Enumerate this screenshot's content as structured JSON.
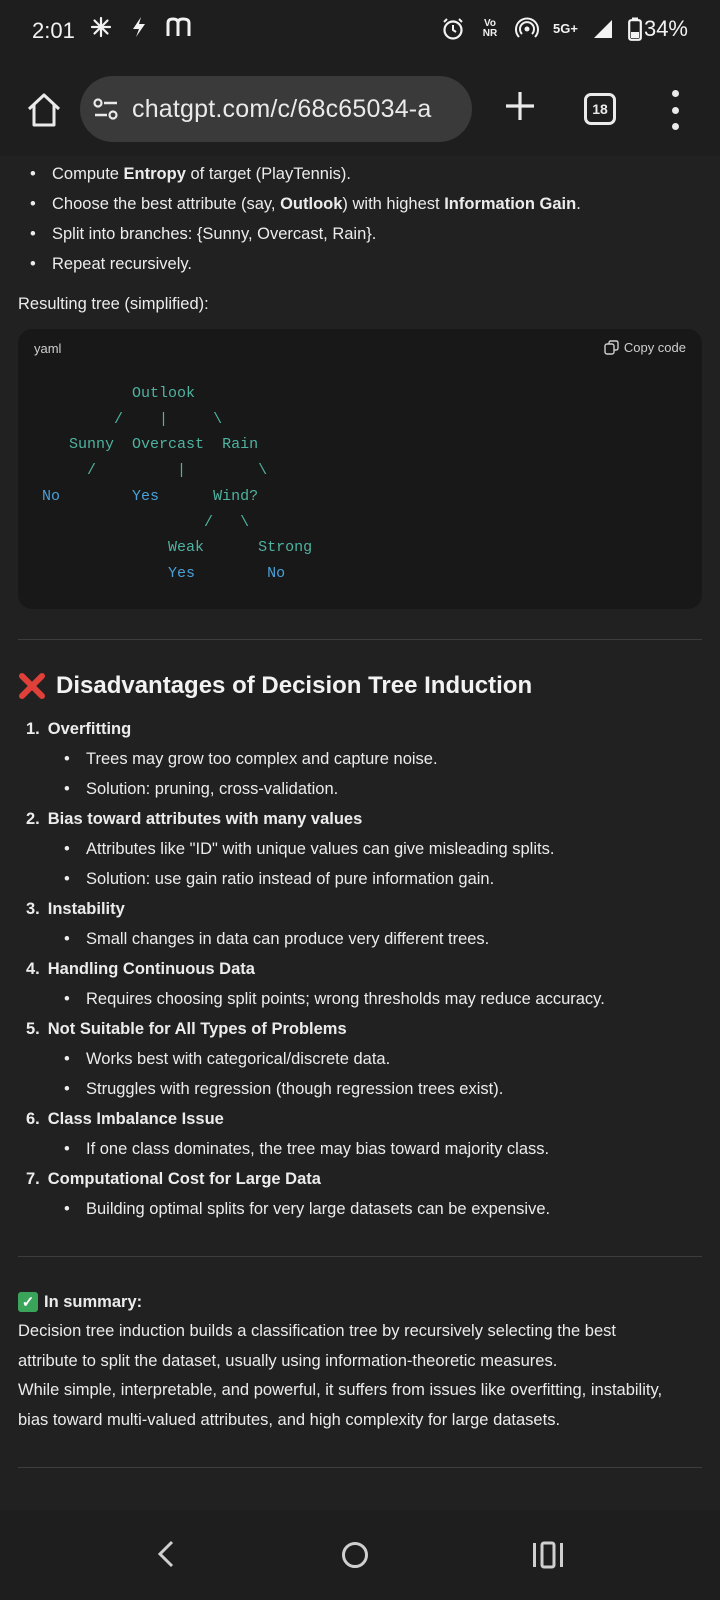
{
  "status_bar": {
    "time": "2:01",
    "left_icons": [
      "pinwheel-icon",
      "lightning-icon",
      "m-app-icon"
    ],
    "volte": "Vo NR",
    "network": "5G+",
    "battery": "34%"
  },
  "browser": {
    "url": "chatgpt.com/c/68c65034-a",
    "tab_count": "18"
  },
  "content": {
    "steps": [
      {
        "parts": [
          {
            "t": "Compute ",
            "b": false
          },
          {
            "t": "Entropy",
            "b": true
          },
          {
            "t": " of target (PlayTennis).",
            "b": false
          }
        ]
      },
      {
        "parts": [
          {
            "t": "Choose the best attribute (say, ",
            "b": false
          },
          {
            "t": "Outlook",
            "b": true
          },
          {
            "t": ") with highest ",
            "b": false
          },
          {
            "t": "Information Gain",
            "b": true
          },
          {
            "t": ".",
            "b": false
          }
        ]
      },
      {
        "parts": [
          {
            "t": "Split into branches: {Sunny, Overcast, Rain}.",
            "b": false
          }
        ]
      },
      {
        "parts": [
          {
            "t": "Repeat recursively.",
            "b": false
          }
        ]
      }
    ],
    "resulting_label": "Resulting tree (simplified):",
    "code": {
      "language": "yaml",
      "copy_label": "Copy code",
      "lines": [
        "          Outlook",
        "        /    |     \\",
        "   Sunny  Overcast  Rain",
        "     /         |        \\",
        "No        Yes      Wind?",
        "                  /   \\",
        "              Weak      Strong",
        "              Yes        No"
      ]
    },
    "disadvantages": {
      "title": "Disadvantages of Decision Tree Induction",
      "items": [
        {
          "number": "1.",
          "title": "Overfitting",
          "bullets": [
            "Trees may grow too complex and capture noise.",
            "Solution: pruning, cross-validation."
          ]
        },
        {
          "number": "2.",
          "title": "Bias toward attributes with many values",
          "bullets": [
            "Attributes like \"ID\" with unique values can give misleading splits.",
            "Solution: use gain ratio instead of pure information gain."
          ]
        },
        {
          "number": "3.",
          "title": "Instability",
          "bullets": [
            "Small changes in data can produce very different trees."
          ]
        },
        {
          "number": "4.",
          "title": "Handling Continuous Data",
          "bullets": [
            "Requires choosing split points; wrong thresholds may reduce accuracy."
          ]
        },
        {
          "number": "5.",
          "title": "Not Suitable for All Types of Problems",
          "bullets": [
            "Works best with categorical/discrete data.",
            "Struggles with regression (though regression trees exist)."
          ]
        },
        {
          "number": "6.",
          "title": "Class Imbalance Issue",
          "bullets": [
            "If one class dominates, the tree may bias toward majority class."
          ]
        },
        {
          "number": "7.",
          "title": "Computational Cost for Large Data",
          "bullets": [
            "Building optimal splits for very large datasets can be expensive."
          ]
        }
      ]
    },
    "summary": {
      "title": "In summary:",
      "lines": [
        "Decision tree induction builds a classification tree by recursively selecting the best",
        "attribute to split the dataset, usually using information-theoretic measures.",
        "While simple, interpretable, and powerful, it suffers from issues like overfitting, instability,",
        "bias toward multi-valued attributes, and high complexity for large datasets."
      ]
    }
  },
  "colors": {
    "background": "#212121",
    "code_keyword": "#4fb3a0",
    "code_value": "#4aa0d8",
    "cross_red": "#e0403a",
    "check_green": "#3aa55a"
  }
}
